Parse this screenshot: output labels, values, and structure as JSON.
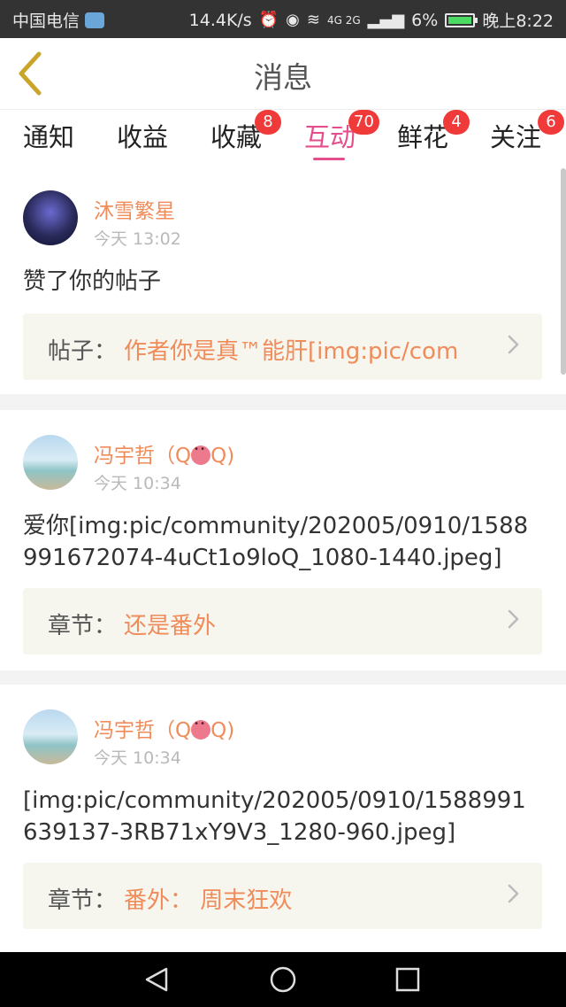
{
  "status_bar": {
    "carrier": "中国电信",
    "speed": "14.4K/s",
    "network": "4G 2G",
    "battery_percent": "6%",
    "time": "晚上8:22",
    "icons": [
      "cloud-icon",
      "alarm-icon",
      "eye-icon",
      "wifi-icon",
      "signal-icon",
      "battery-icon"
    ]
  },
  "header": {
    "title": "消息",
    "back_icon": "chevron-left-icon"
  },
  "tabs": [
    {
      "label": "通知",
      "badge": ""
    },
    {
      "label": "收益",
      "badge": ""
    },
    {
      "label": "收藏",
      "badge": "8"
    },
    {
      "label": "互动",
      "badge": "70",
      "active": true
    },
    {
      "label": "鲜花",
      "badge": "4"
    },
    {
      "label": "关注",
      "badge": "6"
    }
  ],
  "colors": {
    "accent": "#e44e8c",
    "username": "#f08b5a",
    "badge": "#f03a3a"
  },
  "items": [
    {
      "username": "沐雪繁星",
      "time": "今天 13:02",
      "message": "赞了你的帖子",
      "ref_label": "帖子：",
      "ref_value": "作者你是真™能肝[img:pic/com"
    },
    {
      "username_prefix": "冯宇哲（Q",
      "username_suffix": "Q)",
      "time": "今天 10:34",
      "message": "爱你[img:pic/community/202005/0910/1588991672074-4uCt1o9loQ_1080-1440.jpeg]",
      "ref_label": "章节：",
      "ref_value": "还是番外"
    },
    {
      "username_prefix": "冯宇哲（Q",
      "username_suffix": "Q)",
      "time": "今天 10:34",
      "message": "[img:pic/community/202005/0910/1588991639137-3RB71xY9V3_1280-960.jpeg]",
      "ref_label": "章节：",
      "ref_value": "番外： 周末狂欢"
    }
  ],
  "navbar": {
    "buttons": [
      "back-triangle-icon",
      "home-circle-icon",
      "recents-square-icon"
    ]
  }
}
